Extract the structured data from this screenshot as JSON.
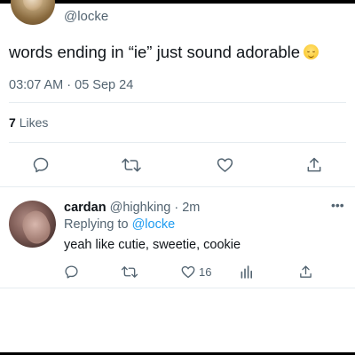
{
  "main_tweet": {
    "handle": "@locke",
    "text": "words ending in “ie” just sound adorable",
    "emoji": "smiling-face-with-closed-eyes",
    "timestamp": "03:07 AM · 05 Sep 24",
    "likes_count": "7",
    "likes_label": "Likes",
    "actions": [
      "reply",
      "retweet",
      "like",
      "share"
    ]
  },
  "reply": {
    "name": "cardan",
    "handle": "@highking",
    "separator": "·",
    "time": "2m",
    "more": "•••",
    "replying_label": "Replying to",
    "replying_to": "@locke",
    "text": "yeah like cutie, sweetie, cookie",
    "like_count": "16",
    "actions": [
      "reply",
      "retweet",
      "like",
      "analytics",
      "share"
    ]
  },
  "colors": {
    "text": "#0f1419",
    "muted": "#536471",
    "link": "#1d9bf0",
    "divider": "#e6ecf0"
  }
}
